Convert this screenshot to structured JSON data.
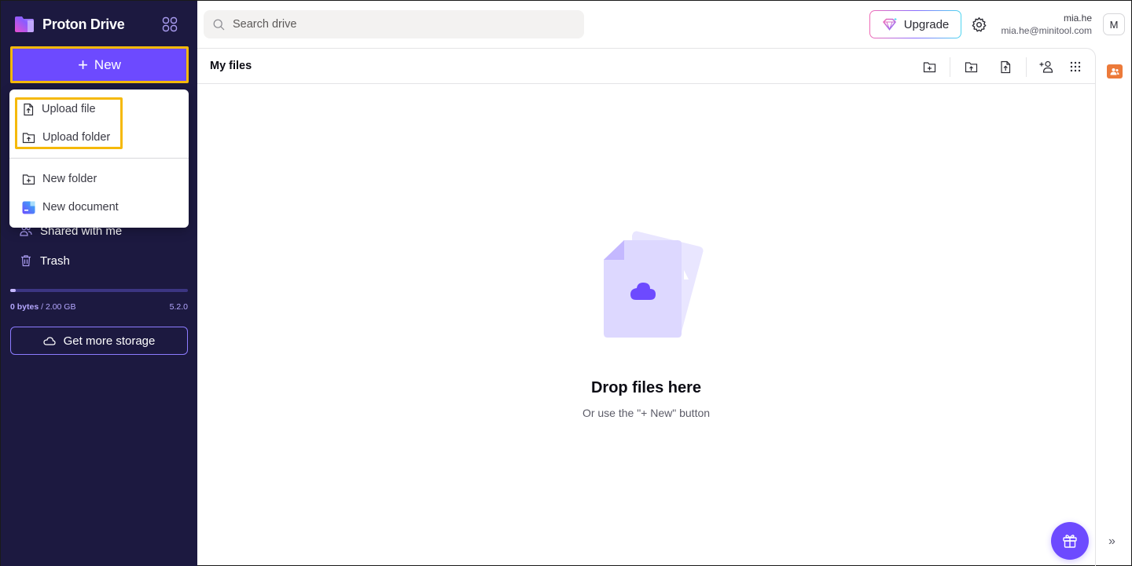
{
  "app": {
    "brand_name": "Proton Drive",
    "accent_color": "#6d4aff",
    "sidebar_bg": "#1c1940"
  },
  "sidebar": {
    "new_button_label": "New",
    "nav_items": [
      {
        "label": "Shared with me",
        "icon": "users-icon"
      },
      {
        "label": "Trash",
        "icon": "trash-icon"
      }
    ],
    "storage": {
      "used": "0 bytes",
      "separator": " / ",
      "total": "2.00 GB",
      "used_fraction": 0.01
    },
    "version": "5.2.0",
    "get_more_storage_label": "Get more storage"
  },
  "new_menu": {
    "items": [
      {
        "label": "Upload file",
        "icon": "file-upload-icon"
      },
      {
        "label": "Upload folder",
        "icon": "folder-upload-icon"
      },
      {
        "label": "New folder",
        "icon": "folder-plus-icon"
      },
      {
        "label": "New document",
        "icon": "document-icon"
      }
    ]
  },
  "topbar": {
    "search_placeholder": "Search drive",
    "upgrade_label": "Upgrade",
    "user": {
      "name": "mia.he",
      "email": "mia.he@minitool.com",
      "initial": "M"
    }
  },
  "main": {
    "title": "My files",
    "toolbar": [
      {
        "name": "new-folder",
        "icon": "folder-plus-icon"
      },
      {
        "name": "upload-folder",
        "icon": "folder-upload-icon"
      },
      {
        "name": "upload-file",
        "icon": "file-upload-icon"
      },
      {
        "name": "share",
        "icon": "user-plus-icon"
      },
      {
        "name": "layout",
        "icon": "grid-dots-icon"
      }
    ],
    "empty_state": {
      "title": "Drop files here",
      "subtitle": "Or use the \"+ New\" button"
    }
  }
}
